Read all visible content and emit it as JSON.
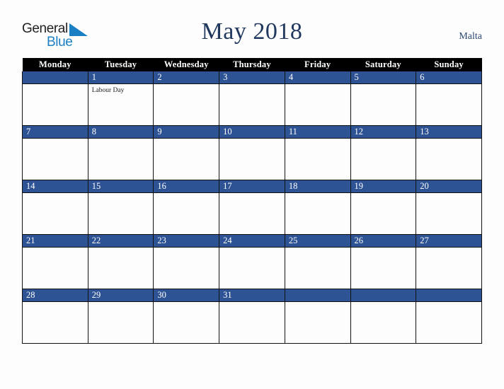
{
  "brand": {
    "name_top": "General",
    "name_bottom": "Blue",
    "triangle_icon": "blue-triangle-icon",
    "color_top": "#231f20",
    "color_bottom": "#1b7fc4"
  },
  "header": {
    "title": "May 2018",
    "region": "Malta",
    "title_color": "#20375e",
    "region_color": "#2d4672"
  },
  "calendar": {
    "month": "May",
    "year": "2018",
    "weekday_headers": [
      "Monday",
      "Tuesday",
      "Wednesday",
      "Thursday",
      "Friday",
      "Saturday",
      "Sunday"
    ],
    "header_bg": "#000000",
    "header_text": "#ffffff",
    "daynum_bg": "#2e5395",
    "daynum_text": "#ffffff",
    "cell_bg": "#fdfdfd",
    "border_color": "#111111",
    "weeks": [
      [
        {
          "day": "",
          "events": []
        },
        {
          "day": "1",
          "events": [
            "Labour Day"
          ]
        },
        {
          "day": "2",
          "events": []
        },
        {
          "day": "3",
          "events": []
        },
        {
          "day": "4",
          "events": []
        },
        {
          "day": "5",
          "events": []
        },
        {
          "day": "6",
          "events": []
        }
      ],
      [
        {
          "day": "7",
          "events": []
        },
        {
          "day": "8",
          "events": []
        },
        {
          "day": "9",
          "events": []
        },
        {
          "day": "10",
          "events": []
        },
        {
          "day": "11",
          "events": []
        },
        {
          "day": "12",
          "events": []
        },
        {
          "day": "13",
          "events": []
        }
      ],
      [
        {
          "day": "14",
          "events": []
        },
        {
          "day": "15",
          "events": []
        },
        {
          "day": "16",
          "events": []
        },
        {
          "day": "17",
          "events": []
        },
        {
          "day": "18",
          "events": []
        },
        {
          "day": "19",
          "events": []
        },
        {
          "day": "20",
          "events": []
        }
      ],
      [
        {
          "day": "21",
          "events": []
        },
        {
          "day": "22",
          "events": []
        },
        {
          "day": "23",
          "events": []
        },
        {
          "day": "24",
          "events": []
        },
        {
          "day": "25",
          "events": []
        },
        {
          "day": "26",
          "events": []
        },
        {
          "day": "27",
          "events": []
        }
      ],
      [
        {
          "day": "28",
          "events": []
        },
        {
          "day": "29",
          "events": []
        },
        {
          "day": "30",
          "events": []
        },
        {
          "day": "31",
          "events": []
        },
        {
          "day": "",
          "events": []
        },
        {
          "day": "",
          "events": []
        },
        {
          "day": "",
          "events": []
        }
      ]
    ]
  }
}
